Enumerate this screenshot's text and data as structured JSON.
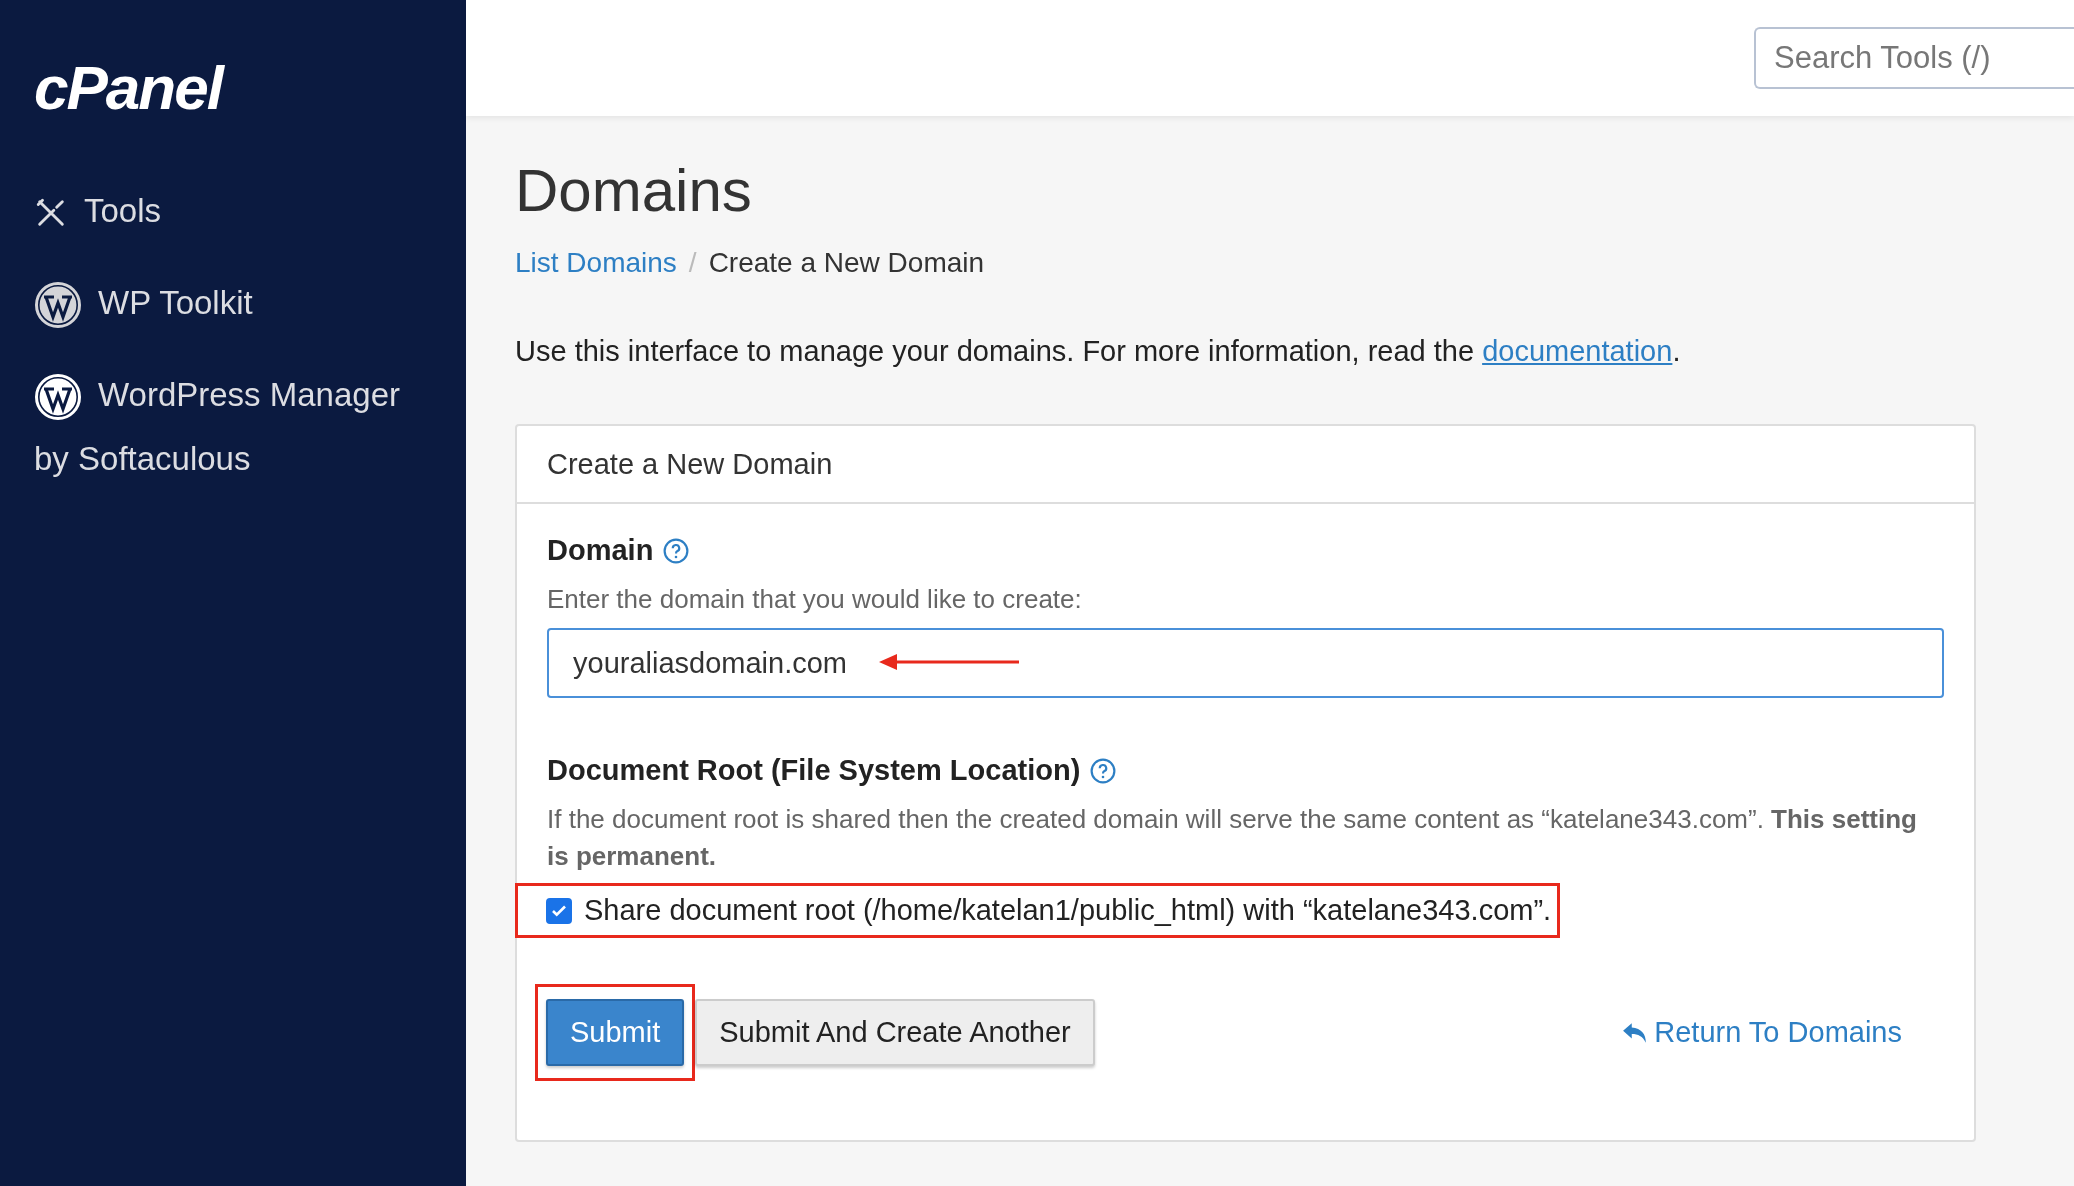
{
  "sidebar": {
    "logo": "cPanel",
    "items": [
      {
        "kind": "tools",
        "label": "Tools"
      },
      {
        "kind": "wordpress",
        "label": "WP Toolkit"
      },
      {
        "kind": "wordpress-solid",
        "label": "WordPress Manager by Softaculous"
      }
    ]
  },
  "header": {
    "search": {
      "placeholder": "Search Tools (/)"
    }
  },
  "page": {
    "title": "Domains",
    "breadcrumb": [
      {
        "label": "List Domains",
        "kind": "link"
      },
      {
        "label": "Create a New Domain",
        "kind": "current"
      }
    ],
    "breadcrumb_separator": "/",
    "intro": {
      "text": "Use this interface to manage your domains. For more information, read the ",
      "link": "documentation",
      "end": "."
    }
  },
  "panel": {
    "title": "Create a New Domain",
    "domain": {
      "label": "Domain",
      "hint": "Enter the domain that you would like to create:",
      "value": "youraliasdomain.com"
    },
    "docroot": {
      "label": "Document Root (File System Location)",
      "hint": "If the document root is shared then the created domain will serve the same content as “katelane343.com”. **This setting is permanent.**",
      "share": {
        "label": "Share document root (/home/katelan1/public_html) with “katelane343.com”.",
        "checked": true
      }
    },
    "buttons": [
      {
        "kind": "primary",
        "label": "Submit"
      },
      {
        "kind": "default",
        "label": "Submit And Create Another"
      }
    ],
    "return_link": "Return To Domains"
  }
}
